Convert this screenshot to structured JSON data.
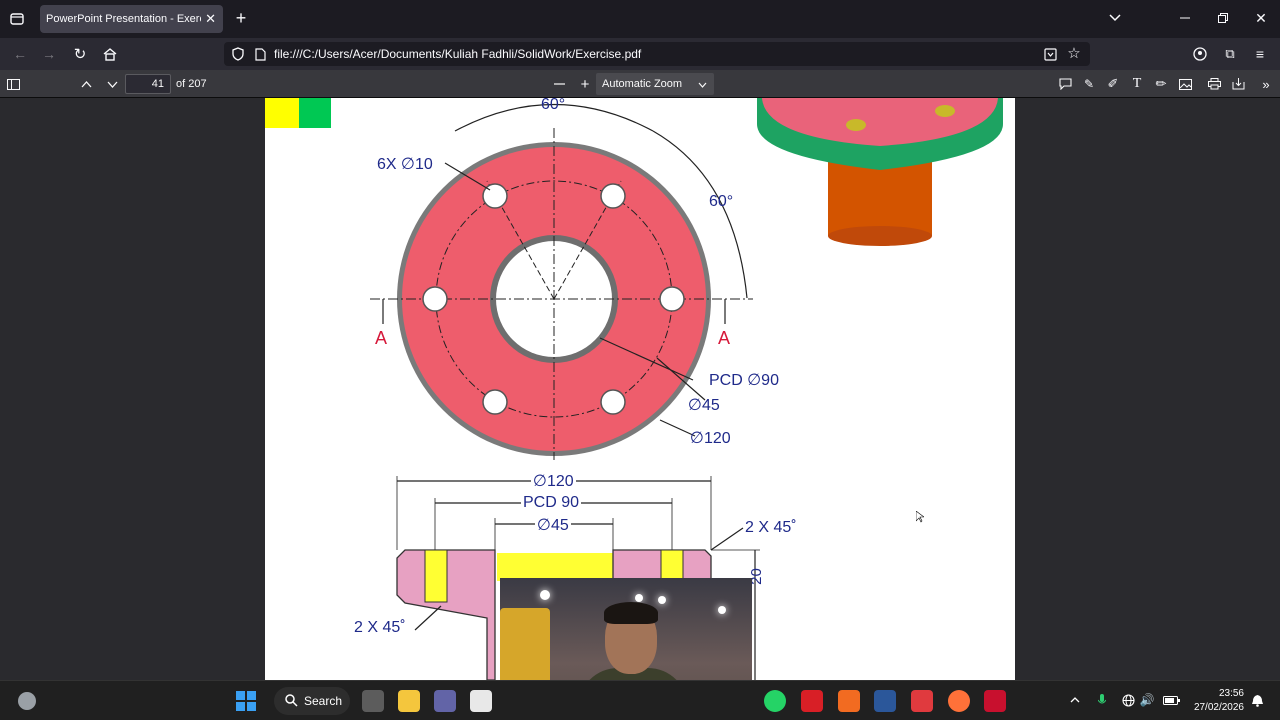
{
  "browser": {
    "tab_title": "PowerPoint Presentation - Exercise.pdf",
    "url": "file:///C:/Users/Acer/Documents/Kuliah Fadhli/SolidWork/Exercise.pdf"
  },
  "pdf_toolbar": {
    "page_number": "41",
    "page_count": "of 207",
    "zoom": "Automatic Zoom"
  },
  "drawing": {
    "angle_top": "60°",
    "angle_right": "60°",
    "holes_label": "6X ∅10",
    "section_left": "A",
    "section_right": "A",
    "pcd_label": "PCD ∅90",
    "bore_label": "∅45",
    "outer_label": "∅120",
    "dim_outer": "∅120",
    "dim_pcd": "PCD 90",
    "dim_bore": "∅45",
    "chamfer_top": "2 X 45˚",
    "chamfer_bottom": "2 X 45˚",
    "dim_height": "20"
  },
  "taskbar": {
    "search_label": "Search",
    "time": "23:56",
    "date": "27/02/2026"
  }
}
